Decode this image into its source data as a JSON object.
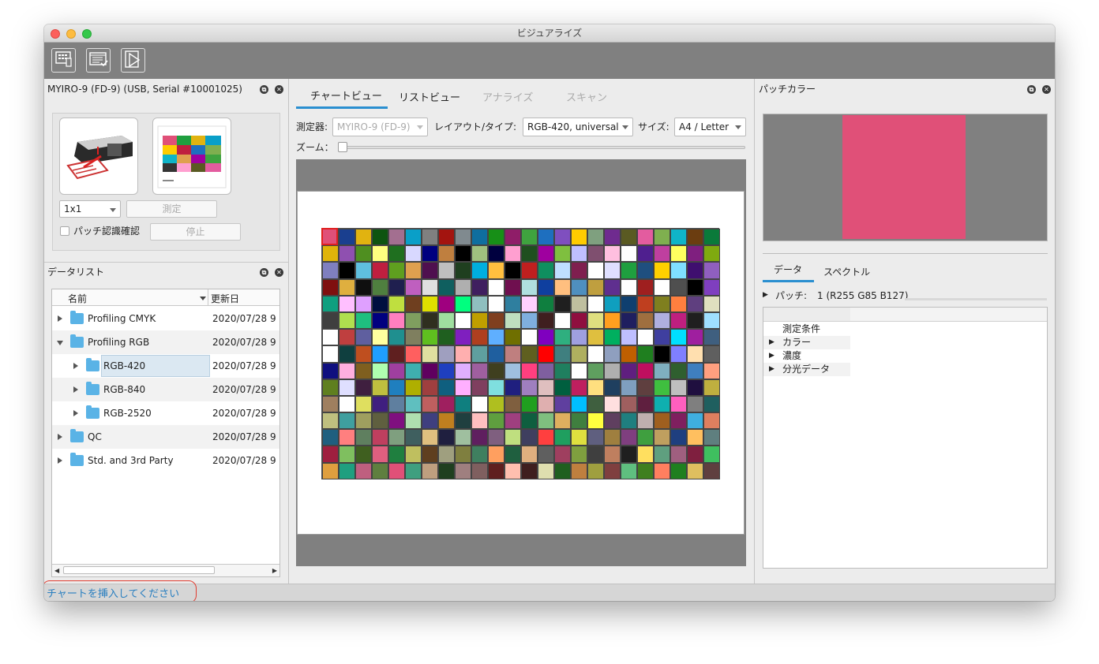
{
  "window": {
    "title": "ビジュアライズ"
  },
  "toolbar": {
    "icons": [
      "measure-device-icon",
      "list-check-icon",
      "chart-view-icon"
    ]
  },
  "device_panel": {
    "title": "MYIRO-9 (FD-9) (USB, Serial #10001025)",
    "patch_select": "1x1",
    "measure_label": "測定",
    "patch_recognition_label": "パッチ認識確認",
    "stop_label": "停止"
  },
  "data_list": {
    "title": "データリスト",
    "col_name": "名前",
    "col_updated": "更新日",
    "rows": [
      {
        "name": "Profiling CMYK",
        "date": "2020/07/28 9"
      },
      {
        "name": "Profiling RGB",
        "date": "2020/07/28 9"
      },
      {
        "name": "RGB-420",
        "date": "2020/07/28 9"
      },
      {
        "name": "RGB-840",
        "date": "2020/07/28 9"
      },
      {
        "name": "RGB-2520",
        "date": "2020/07/28 9"
      },
      {
        "name": "QC",
        "date": "2020/07/28 9"
      },
      {
        "name": "Std. and 3rd Party",
        "date": "2020/07/28 9"
      }
    ]
  },
  "center": {
    "tabs": [
      "チャートビュー",
      "リストビュー",
      "アナライズ",
      "スキャン"
    ],
    "device_label": "測定器:",
    "device_value": "MYIRO-9 (FD-9)",
    "layout_label": "レイアウト/タイプ:",
    "layout_value": "RGB-420, universal",
    "size_label": "サイズ:",
    "size_value": "A4 / Letter",
    "zoom_label": "ズーム：",
    "patch_colors": [
      "#e05078",
      "#1a3f8f",
      "#e1b310",
      "#0e5410",
      "#a36f90",
      "#0a9fc8",
      "#808080",
      "#a3140f",
      "#808a8f",
      "#0f6e9f",
      "#178f17",
      "#8f1d68",
      "#3fa33f",
      "#1e6fbf",
      "#7f4fbf",
      "#ffcc00",
      "#7fa07f",
      "#6f2b8f",
      "#5a5a22",
      "#e35c9f",
      "#7faf4f",
      "#0fb4c8",
      "#6b3d10",
      "#0a7a3a",
      "#dfb40a",
      "#8f50b0",
      "#4f8f20",
      "#ffff80",
      "#1f6f1f",
      "#d8d8ff",
      "#00007f",
      "#bf7f3f",
      "#000000",
      "#9fbf7f",
      "#00003f",
      "#ff9fd0",
      "#1f4f1f",
      "#9f009f",
      "#7fbf3f",
      "#bfbfff",
      "#7f4f6f",
      "#ffbfdf",
      "#ffffff",
      "#4f1f8f",
      "#bf3f9f",
      "#ffff5f",
      "#7f1f7f",
      "#7faa10",
      "#7f7fbf",
      "#000000",
      "#5fbfdf",
      "#bf1f3f",
      "#5f9f1f",
      "#dfa04f",
      "#4f0f4f",
      "#bfbfbf",
      "#1f3f1f",
      "#00afdf",
      "#ffbf3f",
      "#000000",
      "#bf1f1f",
      "#0f8f5f",
      "#bfdfff",
      "#7f1f4f",
      "#ffffff",
      "#dfdfff",
      "#1f9f3f",
      "#1f4f7f",
      "#ffd000",
      "#7fdfff",
      "#3f0f6f",
      "#8f5fbf",
      "#7f0f0f",
      "#dfaf3f",
      "#0f0f0f",
      "#4f7f3f",
      "#1f1f4f",
      "#bf5fbf",
      "#dfdfdf",
      "#0f5f5f",
      "#afafaf",
      "#3f1f5f",
      "#ffffff",
      "#6f0f4f",
      "#afdfdf",
      "#0f3f9f",
      "#ffbf7f",
      "#4f8fbf",
      "#bf9f3f",
      "#5f2f8f",
      "#ffffff",
      "#9f1f1f",
      "#ffffff",
      "#4f4f4f",
      "#000000",
      "#7f3fbf",
      "#0f9f7f",
      "#ffbfff",
      "#dfa0ff",
      "#000f3f",
      "#bfdf3f",
      "#6f3f1f",
      "#dfdf00",
      "#9f007f",
      "#00ff7f",
      "#8fbfbf",
      "#ffffff",
      "#2f7f9f",
      "#ffd0ff",
      "#0f7f3f",
      "#1f1f1f",
      "#bfbf9f",
      "#ffffff",
      "#0f9fbf",
      "#0f3f6f",
      "#bf3f1f",
      "#7f7f1f",
      "#ff7f3f",
      "#5f3f7f",
      "#dfdfbf",
      "#3f3f3f",
      "#afdf4f",
      "#1fbf7f",
      "#00007f",
      "#ff7fbf",
      "#7f9f5f",
      "#2f2f1f",
      "#9fdf9f",
      "#ffffff",
      "#bf9f00",
      "#7f3f1f",
      "#bfdfbf",
      "#7fafdf",
      "#3f1f1f",
      "#ffffff",
      "#8f0f3f",
      "#dfdf7f",
      "#ff9f1f",
      "#1f1f5f",
      "#9f6f3f",
      "#afafdf",
      "#bf1f7f",
      "#1f1f1f",
      "#9fdfff",
      "#ffffff",
      "#bf3f3f",
      "#5f5f9f",
      "#ffff9f",
      "#1f8f8f",
      "#7f7f5f",
      "#5fbf1f",
      "#1f5f1f",
      "#7f1fbf",
      "#af3f1f",
      "#5fafff",
      "#6f6f00",
      "#ffffff",
      "#7f00bf",
      "#2faf7f",
      "#9f9fdf",
      "#dfbf3f",
      "#00af5f",
      "#bfbfff",
      "#ffffff",
      "#3f3f9f",
      "#00dfff",
      "#9f1f9f",
      "#3f5f7f",
      "#ffffff",
      "#0f3f3f",
      "#bf4f1f",
      "#1f9fff",
      "#5f1f1f",
      "#ff5f5f",
      "#dfdf9f",
      "#9f9fbf",
      "#ffafaf",
      "#5f9f9f",
      "#1f5f9f",
      "#bf7f7f",
      "#5f5f1f",
      "#ff0000",
      "#3f7f7f",
      "#afaf5f",
      "#ffffff",
      "#8f9fbf",
      "#bf5f00",
      "#1f7f1f",
      "#000000",
      "#7f7fff",
      "#ffdfaf",
      "#5f5f5f",
      "#0f0f7f",
      "#ffafdf",
      "#7f5f1f",
      "#afffaf",
      "#9f3f9f",
      "#3fafaf",
      "#5f005f",
      "#1f3fbf",
      "#dfafff",
      "#9f5f9f",
      "#3f3f1f",
      "#9fbfdf",
      "#ff3f7f",
      "#7f5f9f",
      "#1f7f5f",
      "#ffffff",
      "#5f9f5f",
      "#afafaf",
      "#5f1f7f",
      "#bf0f5f",
      "#7fafbf",
      "#2f5f2f",
      "#3f7fbf",
      "#ff9f7f",
      "#5f7f1f",
      "#dfdfff",
      "#3f1f3f",
      "#bfbf3f",
      "#1f7fbf",
      "#afaf00",
      "#9f3f3f",
      "#0f5f7f",
      "#ffafff",
      "#7f3f5f",
      "#7fdfdf",
      "#1f1f7f",
      "#9f7fbf",
      "#dfbfbf",
      "#005f3f",
      "#bf1f5f",
      "#ffdf7f",
      "#1f3f5f",
      "#7f9fbf",
      "#5f3f3f",
      "#3fbf3f",
      "#bfbfbf",
      "#1f0f3f",
      "#bfaf3f",
      "#9f7f5f",
      "#ffffff",
      "#dfdf5f",
      "#3f1f7f",
      "#5f7f9f",
      "#5fbfbf",
      "#bf5f5f",
      "#9f1f5f",
      "#0f7f7f",
      "#ffffff",
      "#afbf1f",
      "#7f5f3f",
      "#1f9f1f",
      "#dfafaf",
      "#5f3f9f",
      "#00bfff",
      "#3f5f3f",
      "#ffdfdf",
      "#9f5f5f",
      "#5f1f3f",
      "#0fafaf",
      "#ff5fbf",
      "#7f7f7f",
      "#1f5f5f",
      "#bfbf7f",
      "#3f9f9f",
      "#9f9f5f",
      "#5f5f3f",
      "#7f0f7f",
      "#afdfaf",
      "#3f3f7f",
      "#bf7f1f",
      "#1f3f3f",
      "#ffbfbf",
      "#5f9f3f",
      "#9f3f7f",
      "#0f5f3f",
      "#7fbf7f",
      "#dfaf5f",
      "#3f7f3f",
      "#ffff3f",
      "#5f3f5f",
      "#1f7f7f",
      "#bfafaf",
      "#9f5f1f",
      "#7f1f5f",
      "#3fafdf",
      "#df7f5f",
      "#1f5f7f",
      "#ff7f7f",
      "#5f7f5f",
      "#bf3f5f",
      "#7f9f7f",
      "#3f5f5f",
      "#dfbf7f",
      "#1f1f3f",
      "#9fbf9f",
      "#5f1f5f",
      "#7f5f7f",
      "#bfdf7f",
      "#3f3f5f",
      "#ff3f3f",
      "#1f9f5f",
      "#dfdf3f",
      "#5f5f7f",
      "#9f7f3f",
      "#7f3f7f",
      "#3f9f3f",
      "#bf9f5f",
      "#1f3f7f",
      "#ffbf5f",
      "#5f7f7f",
      "#9f1f3f",
      "#7fbf5f",
      "#3f5f1f",
      "#df5f7f",
      "#1f7f3f",
      "#bfbf5f",
      "#5f3f1f",
      "#9f9f7f",
      "#7f7f3f",
      "#3f7f5f",
      "#ff9f5f",
      "#1f5f3f",
      "#dfaf7f",
      "#5f5f5f",
      "#9f3f5f",
      "#7f9f3f",
      "#3f3f3f",
      "#bf7f5f",
      "#1f1f1f",
      "#ffdf5f",
      "#5f9f7f",
      "#9f5f7f",
      "#7f1f3f",
      "#3fbf5f",
      "#df9f3f",
      "#1f9f7f",
      "#bf5f7f",
      "#5f7f3f",
      "#e05078",
      "#3f9f7f",
      "#bf9f7f",
      "#1f3f1f",
      "#9f7f7f",
      "#7f5f5f",
      "#5f1f1f",
      "#ffbfaf",
      "#3f1f1f",
      "#dfdfaf",
      "#1f5f1f",
      "#bf7f3f",
      "#9f9f3f",
      "#7f3f3f",
      "#5fbf7f",
      "#3f7f1f",
      "#ff7f5f",
      "#1f7f1f",
      "#dfbf5f",
      "#5f3f3f",
      "#9f1f1f"
    ]
  },
  "patch_color": {
    "title": "パッチカラー",
    "swatch": "#e05078"
  },
  "detail": {
    "tabs": [
      "データ",
      "スペクトル"
    ],
    "patch_label": "パッチ:",
    "patch_value": "1 (R255 G85 B127)",
    "tree": [
      "測定条件",
      "カラー",
      "濃度",
      "分光データ"
    ]
  },
  "status": {
    "message": "チャートを挿入してください"
  }
}
